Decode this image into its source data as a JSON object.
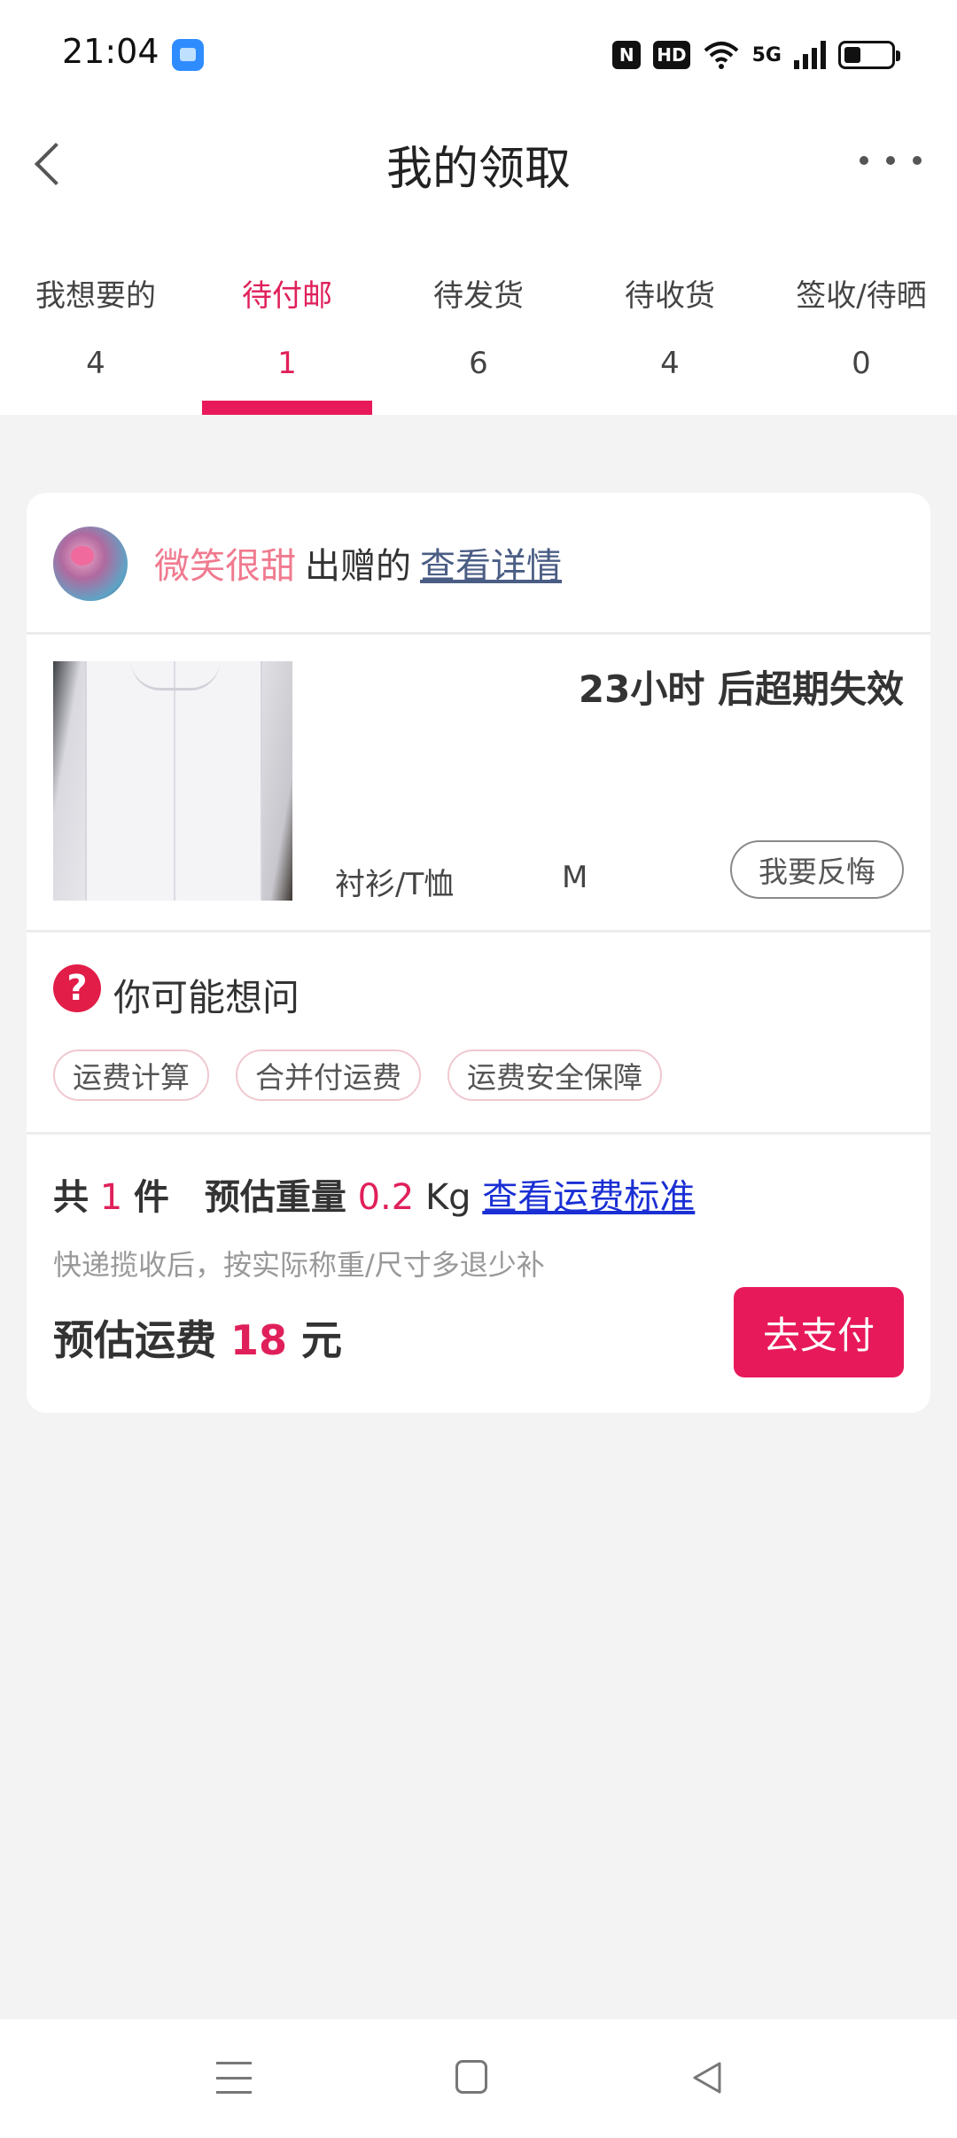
{
  "status_bar": {
    "time": "21:04",
    "app_icon": "blue-app-icon",
    "nfc_label": "N",
    "hd_label": "HD",
    "network_label": "5G",
    "wifi_icon": "wifi-icon",
    "battery_level": 0.35
  },
  "header": {
    "title": "我的领取",
    "back_icon": "chevron-left-icon",
    "more_icon": "more-dots-icon"
  },
  "tabs": [
    {
      "label": "我想要的",
      "count": "4"
    },
    {
      "label": "待付邮",
      "count": "1",
      "active": true
    },
    {
      "label": "待发货",
      "count": "6"
    },
    {
      "label": "待收货",
      "count": "4"
    },
    {
      "label": "签收/待晒",
      "count": "0"
    }
  ],
  "colors": {
    "accent": "#e8195a",
    "giver_name": "#f07a8f",
    "link": "#1a2fd4",
    "background": "#f3f3f3"
  },
  "order": {
    "giver_name": "微笑很甜",
    "giver_suffix": "出赠的",
    "details_link": "查看详情",
    "expire_text": "23小时 后超期失效",
    "category": "衬衫/T恤",
    "size": "M",
    "regret_button": "我要反悔"
  },
  "faq": {
    "icon": "question-icon",
    "title": "你可能想问",
    "chips": [
      "运费计算",
      "合并付运费",
      "运费安全保障"
    ]
  },
  "summary": {
    "total_prefix": "共",
    "count": "1",
    "count_unit": "件",
    "weight_label": "预估重量",
    "weight_value": "0.2",
    "weight_unit": "Kg",
    "standard_link": "查看运费标准",
    "note": "快递揽收后，按实际称重/尺寸多退少补",
    "fee_label": "预估运费",
    "fee_value": "18",
    "fee_unit": "元",
    "pay_button": "去支付"
  },
  "nav": {
    "menu_icon": "menu-icon",
    "home_icon": "home-square-icon",
    "back_icon": "back-triangle-icon"
  }
}
